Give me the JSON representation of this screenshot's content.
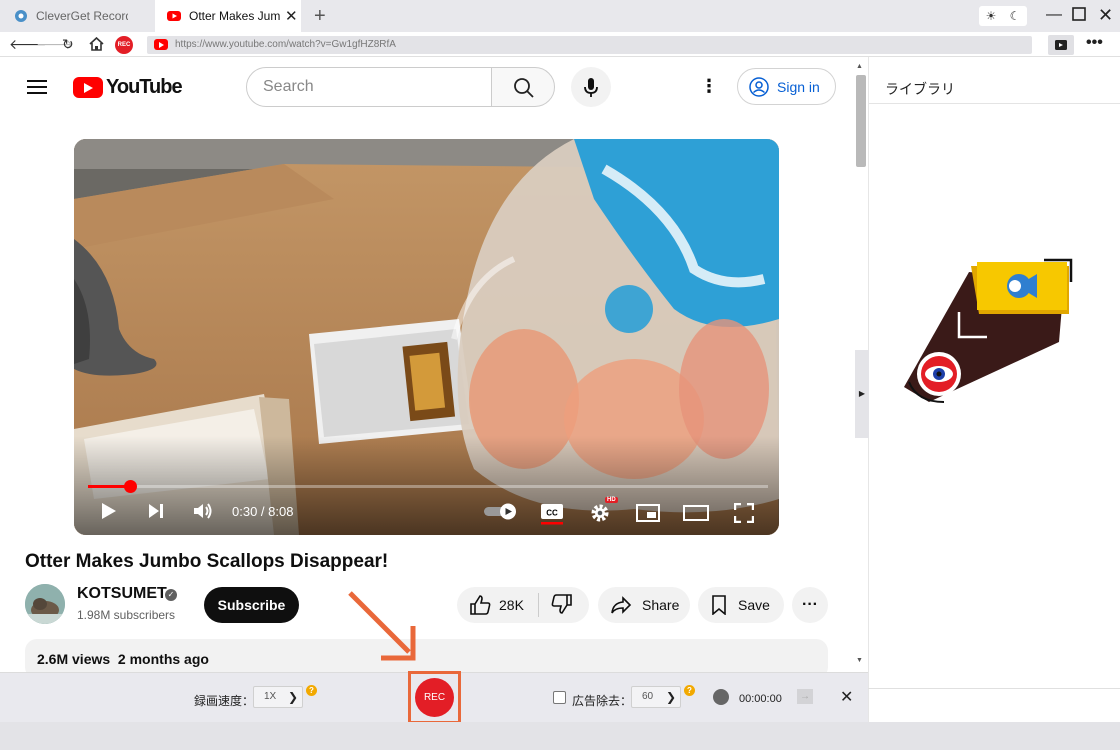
{
  "browser": {
    "tabs": [
      {
        "title": "CleverGet Recorder",
        "active": false
      },
      {
        "title": "Otter Makes Jumbo Scallops Disappear!",
        "active": true
      }
    ],
    "new_tab_label": "+",
    "url": "https://www.youtube.com/watch?v=Gw1gfHZ8RfA",
    "rec_badge": "REC"
  },
  "youtube": {
    "logo_text": "YouTube",
    "search_placeholder": "Search",
    "sign_in_label": "Sign in",
    "video": {
      "current_time": "0:30",
      "duration": "8:08",
      "time_display": "0:30 / 8:08",
      "progress_fraction": 0.0615,
      "hd_badge": "HD"
    },
    "title": "Otter Makes Jumbo Scallops Disappear!",
    "channel_name": "KOTSUMET",
    "subscribers": "1.98M subscribers",
    "subscribe_label": "Subscribe",
    "likes": "28K",
    "share_label": "Share",
    "save_label": "Save",
    "views_and_date": "2.6M views  2 months ago"
  },
  "sidebar": {
    "title": "ライブラリ"
  },
  "recorder_toolbar": {
    "speed_label": "録画速度：",
    "speed_value": "1X",
    "rec_label": "REC",
    "ad_removal_label": "広告除去：",
    "ad_removal_value": "60",
    "ad_removal_checked": false,
    "timer_value": "00:00:00",
    "help_mark": "?"
  },
  "colors": {
    "accent_red": "#e31e26",
    "highlight_orange": "#e9683a",
    "youtube_red": "#ff0000",
    "link_blue": "#065fd4"
  }
}
